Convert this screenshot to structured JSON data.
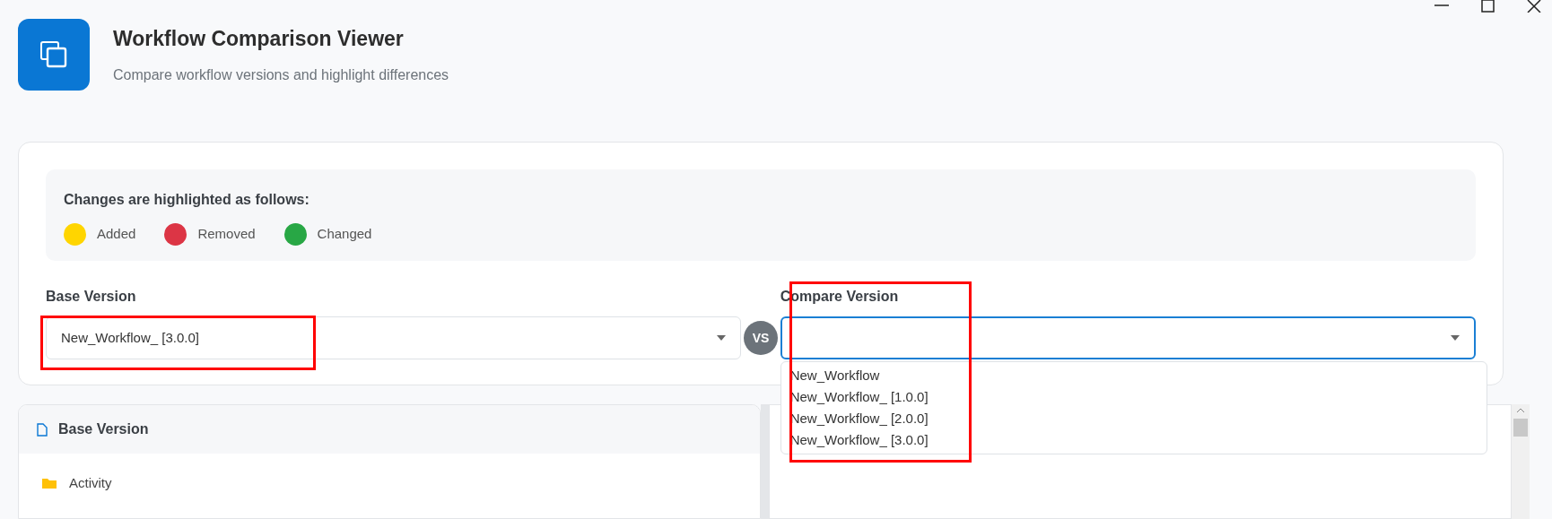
{
  "app": {
    "title": "Workflow Comparison Viewer",
    "subtitle": "Compare workflow versions and highlight differences"
  },
  "legend": {
    "heading": "Changes are highlighted as follows:",
    "items": [
      {
        "label": "Added",
        "color": "#ffd500"
      },
      {
        "label": "Removed",
        "color": "#dc3545"
      },
      {
        "label": "Changed",
        "color": "#28a745"
      }
    ]
  },
  "base_select": {
    "label": "Base Version",
    "value": "New_Workflow_ [3.0.0]"
  },
  "vs_badge": "VS",
  "compare_select": {
    "label": "Compare Version",
    "focused": true,
    "options": [
      {
        "label": "New_Workflow"
      },
      {
        "label": "New_Workflow_ [1.0.0]"
      },
      {
        "label": "New_Workflow_ [2.0.0]"
      },
      {
        "label": "New_Workflow_ [3.0.0]"
      }
    ]
  },
  "base_panel": {
    "title": "Base Version",
    "tree": [
      {
        "label": "Activity",
        "kind": "folder"
      }
    ]
  }
}
